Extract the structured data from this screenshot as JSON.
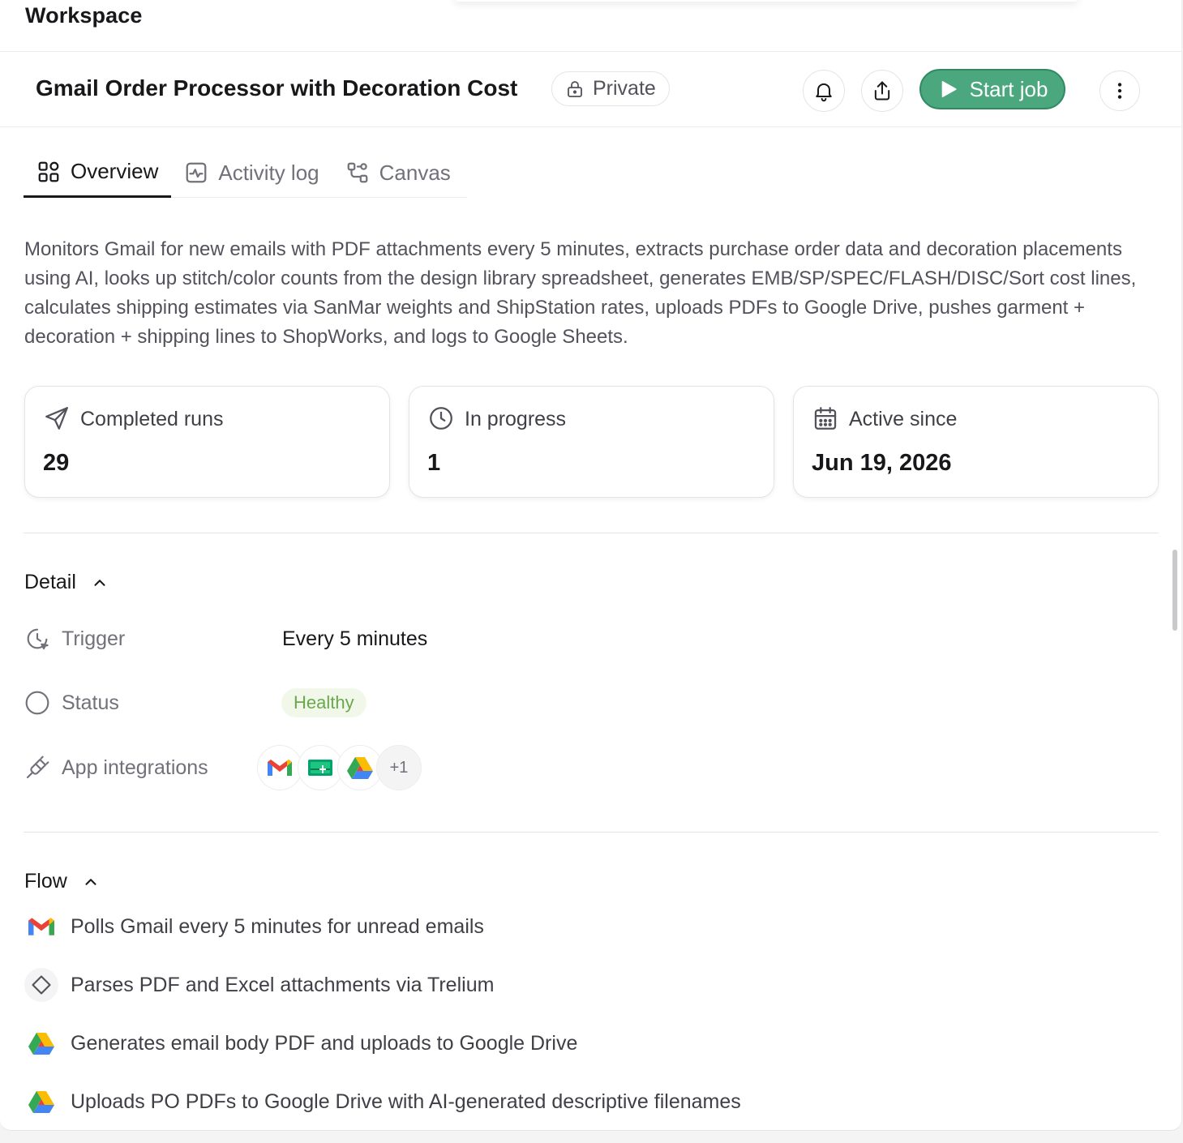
{
  "workspace": {
    "title": "Workspace"
  },
  "header": {
    "job_title": "Gmail Order Processor with Decoration Cost",
    "visibility": "Private",
    "bell_icon": "bell-icon",
    "share_icon": "share-icon",
    "start_label": "Start job",
    "more_icon": "more-vertical-icon",
    "accent": "#4aa77e"
  },
  "tabs": [
    {
      "label": "Overview",
      "icon": "grid-icon",
      "active": true
    },
    {
      "label": "Activity log",
      "icon": "activity-icon",
      "active": false
    },
    {
      "label": "Canvas",
      "icon": "workflow-icon",
      "active": false
    }
  ],
  "description": "Monitors Gmail for new emails with PDF attachments every 5 minutes, extracts purchase order data and decoration placements using AI, looks up stitch/color counts from the design library spreadsheet, generates EMB/SP/SPEC/FLASH/DISC/Sort cost lines, calculates shipping estimates via SanMar weights and ShipStation rates, uploads PDFs to Google Drive, pushes garment + decoration + shipping lines to ShopWorks, and logs to Google Sheets.",
  "stats": [
    {
      "label": "Completed runs",
      "value": "29",
      "icon": "send-icon"
    },
    {
      "label": "In progress",
      "value": "1",
      "icon": "clock-icon"
    },
    {
      "label": "Active since",
      "value": "Jun 19, 2026",
      "icon": "calendar-icon"
    }
  ],
  "detail": {
    "title": "Detail",
    "trigger_label": "Trigger",
    "trigger_value": "Every 5 minutes",
    "status_label": "Status",
    "status_value": "Healthy",
    "status_color": "#6aa84f",
    "integrations_label": "App integrations",
    "integrations": [
      "gmail-icon",
      "google-sheets-icon",
      "google-drive-icon"
    ],
    "integrations_more": "+1"
  },
  "flow": {
    "title": "Flow",
    "items": [
      {
        "text": "Polls Gmail every 5 minutes for unread emails",
        "icon": "gmail-icon"
      },
      {
        "text": "Parses PDF and Excel attachments via Trelium",
        "icon": "diamond-icon"
      },
      {
        "text": "Generates email body PDF and uploads to Google Drive",
        "icon": "google-drive-icon"
      },
      {
        "text": "Uploads PO PDFs to Google Drive with AI-generated descriptive filenames",
        "icon": "google-drive-icon"
      }
    ]
  }
}
